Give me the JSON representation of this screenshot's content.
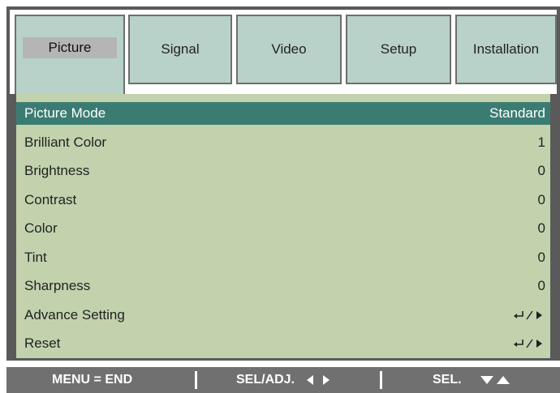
{
  "tabs": [
    {
      "label": "Picture",
      "active": true
    },
    {
      "label": "Signal",
      "active": false
    },
    {
      "label": "Video",
      "active": false
    },
    {
      "label": "Setup",
      "active": false
    },
    {
      "label": "Installation",
      "active": false
    }
  ],
  "menu": {
    "items": [
      {
        "label": "Picture Mode",
        "value": "Standard",
        "selected": true
      },
      {
        "label": "Brilliant Color",
        "value": "1"
      },
      {
        "label": "Brightness",
        "value": "0"
      },
      {
        "label": "Contrast",
        "value": "0"
      },
      {
        "label": "Color",
        "value": "0"
      },
      {
        "label": "Tint",
        "value": "0"
      },
      {
        "label": "Sharpness",
        "value": "0"
      },
      {
        "label": "Advance Setting",
        "icon": "enter-right-icon"
      },
      {
        "label": "Reset",
        "icon": "enter-right-icon"
      }
    ]
  },
  "footer": {
    "menu_end": "MENU = END",
    "sel_adj": "SEL/ADJ.",
    "sel": "SEL."
  },
  "colors": {
    "tab_bg": "#b9d2c9",
    "content_bg": "#c2d2ad",
    "selected_row": "#3b7c72",
    "footer_bg": "#707070"
  }
}
